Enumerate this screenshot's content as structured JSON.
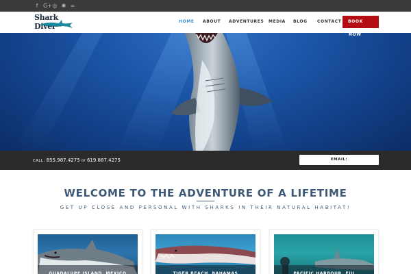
{
  "colors": {
    "accent_blue": "#3c8ec8",
    "book_red": "#b40d14",
    "topbar": "#3a3a3a",
    "contact_strip": "#2b2b2b",
    "heading": "#3d5876"
  },
  "social": [
    {
      "icon": "facebook-icon",
      "glyph": "f"
    },
    {
      "icon": "google-plus-icon",
      "glyph": "G+"
    },
    {
      "icon": "instagram-icon",
      "glyph": "◎"
    },
    {
      "icon": "yelp-icon",
      "glyph": "✱"
    },
    {
      "icon": "tripadvisor-icon",
      "glyph": "∞"
    }
  ],
  "logo": {
    "text": "Shark Diver"
  },
  "nav": {
    "home": "HOME",
    "about": "ABOUT",
    "adventures": "ADVENTURES",
    "media": "MEDIA",
    "blog": "BLOG",
    "contact": "CONTACT",
    "book_line1": "BOOK",
    "book_line2": "NOW"
  },
  "contact": {
    "call_label": "CALL:",
    "phone1": "855.987.4275",
    "or": "or",
    "phone2": "619.887.4275",
    "email_label": "EMAIL:"
  },
  "welcome": {
    "title": "WELCOME TO THE ADVENTURE OF A LIFETIME",
    "subtitle": "GET UP CLOSE AND PERSONAL WITH SHARKS IN THEIR NATURAL HABITAT!"
  },
  "cards": [
    {
      "caption": "GUADALUPE ISLAND, MEXICO"
    },
    {
      "caption": "TIGER BEACH, BAHAMAS"
    },
    {
      "caption": "PACIFIC HARBOUR, FIJI"
    }
  ]
}
